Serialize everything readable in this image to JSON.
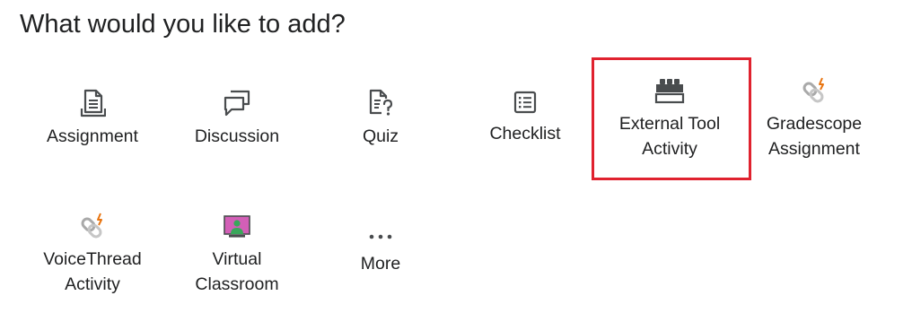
{
  "dialog": {
    "title": "What would you like to add?"
  },
  "options": [
    {
      "id": "assignment",
      "label": "Assignment",
      "icon": "assignment-icon"
    },
    {
      "id": "discussion",
      "label": "Discussion",
      "icon": "discussion-icon"
    },
    {
      "id": "quiz",
      "label": "Quiz",
      "icon": "quiz-icon"
    },
    {
      "id": "checklist",
      "label": "Checklist",
      "icon": "checklist-icon"
    },
    {
      "id": "external-tool",
      "label_line1": "External Tool",
      "label_line2": "Activity",
      "icon": "lego-brick-icon",
      "highlighted": true
    },
    {
      "id": "gradescope",
      "label_line1": "Gradescope",
      "label_line2": "Assignment",
      "icon": "chain-link-icon"
    },
    {
      "id": "voicethread",
      "label_line1": "VoiceThread",
      "label_line2": "Activity",
      "icon": "chain-link-icon"
    },
    {
      "id": "virtual-classroom",
      "label_line1": "Virtual",
      "label_line2": "Classroom",
      "icon": "video-presenter-icon"
    },
    {
      "id": "more",
      "label": "More",
      "icon": "ellipsis-icon"
    }
  ],
  "colors": {
    "highlight_border": "#e0222f",
    "icon_stroke": "#494c4e",
    "link_accent": "#e87511",
    "presenter_screen": "#d35fb7",
    "presenter_person": "#3aa75b"
  }
}
